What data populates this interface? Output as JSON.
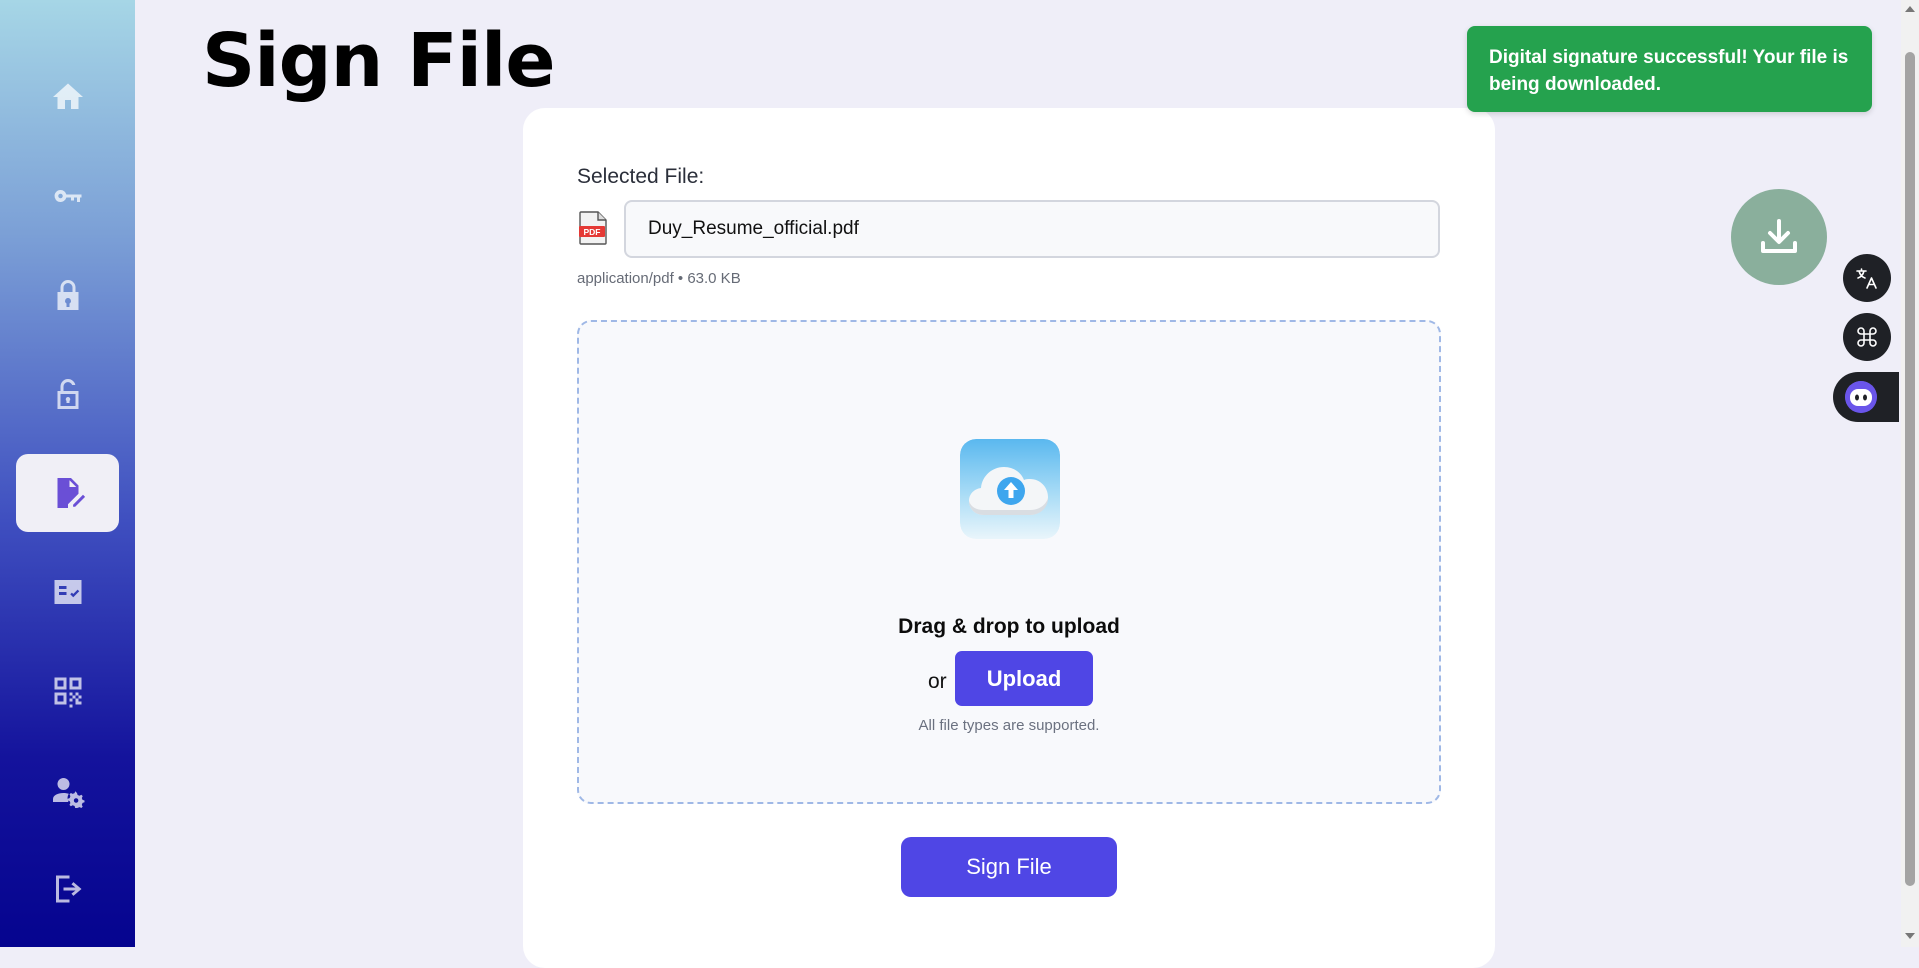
{
  "page": {
    "title": "Sign File"
  },
  "sidebar": {
    "items": [
      {
        "icon": "home-icon"
      },
      {
        "icon": "key-icon"
      },
      {
        "icon": "lock-icon"
      },
      {
        "icon": "unlock-icon"
      },
      {
        "icon": "file-signature-icon",
        "active": true
      },
      {
        "icon": "verify-checklist-icon"
      },
      {
        "icon": "qr-code-icon"
      },
      {
        "icon": "user-settings-icon"
      },
      {
        "icon": "logout-icon"
      }
    ]
  },
  "file": {
    "label": "Selected File:",
    "name": "Duy_Resume_official.pdf",
    "meta": "application/pdf • 63.0 KB",
    "icon_text": "PDF"
  },
  "dropzone": {
    "heading": "Drag & drop to upload",
    "or_text": "or",
    "upload_label": "Upload",
    "hint": "All file types are supported."
  },
  "actions": {
    "sign_label": "Sign File"
  },
  "toast": {
    "message": "Digital signature successful! Your file is being downloaded."
  },
  "colors": {
    "accent": "#4f46e5",
    "toast_success": "#25a24e",
    "download_fab": "#8aaf9c"
  }
}
